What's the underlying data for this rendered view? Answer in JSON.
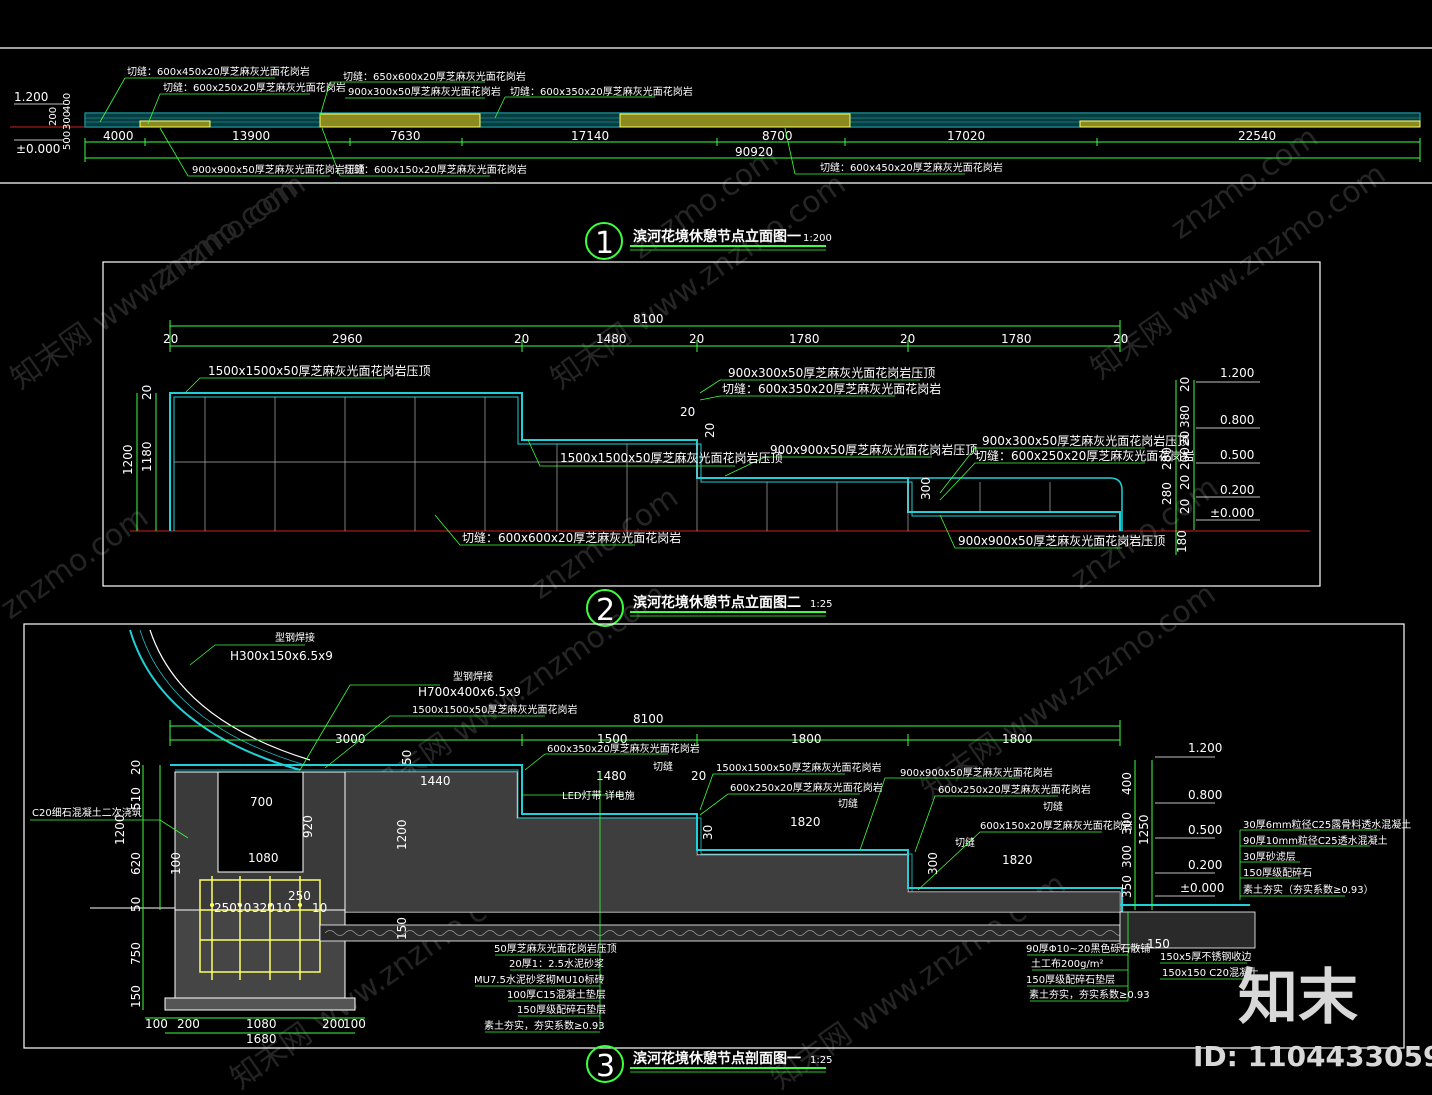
{
  "colors": {
    "background": "#000000",
    "frame": "#ffffff",
    "paving": "#1fd0d8",
    "coping": "#ffff66",
    "leader": "#3cff3c",
    "ground": "#d02020"
  },
  "drawing1": {
    "number": "1",
    "title": "滨河花境休憩节点立面图一",
    "scale": "1:200",
    "levels": [
      "1.200",
      "±0.000"
    ],
    "vertical_dims": [
      "200",
      "500",
      "300",
      "400"
    ],
    "segments": [
      "4000",
      "13900",
      "7630",
      "17140",
      "8700",
      "17020",
      "22540"
    ],
    "total": "90920",
    "notes": {
      "top_a": "切缝：600x450x20厚芝麻灰光面花岗岩",
      "top_b": "切缝：600x250x20厚芝麻灰光面花岗岩",
      "top_c": "切缝：650x600x20厚芝麻灰光面花岗岩",
      "top_d": "900x300x50厚芝麻灰光面花岗岩",
      "top_e": "切缝：600x350x20厚芝麻灰光面花岗岩",
      "bot_a": "900x900x50厚芝麻灰光面花岗岩压顶",
      "bot_b": "切缝：600x150x20厚芝麻灰光面花岗岩",
      "bot_c": "切缝：600x450x20厚芝麻灰光面花岗岩"
    }
  },
  "drawing2": {
    "number": "2",
    "title": "滨河花境休憩节点立面图二",
    "scale": "1:25",
    "total": "8100",
    "top_dims": [
      "20",
      "2960",
      "20",
      "1480",
      "20",
      "1780",
      "20",
      "1780",
      "20"
    ],
    "left_dims": [
      "1200",
      "1180",
      "20"
    ],
    "mid_dims": [
      "20",
      "20",
      "300"
    ],
    "right_dims": [
      "20",
      "380",
      "20",
      "200",
      "280",
      "20",
      "280",
      "20",
      "180"
    ],
    "levels": [
      "1.200",
      "0.800",
      "0.500",
      "0.200",
      "±0.000"
    ],
    "notes": {
      "a": "1500x1500x50厚芝麻灰光面花岗岩压顶",
      "b": "900x300x50厚芝麻灰光面花岗岩压顶",
      "c": "切缝：600x350x20厚芝麻灰光面花岗岩",
      "d": "1500x1500x50厚芝麻灰光面花岗岩压顶",
      "e": "900x900x50厚芝麻灰光面花岗岩压顶",
      "f": "900x300x50厚芝麻灰光面花岗岩压顶",
      "g": "切缝：600x250x20厚芝麻灰光面花岗岩",
      "h": "切缝：600x600x20厚芝麻灰光面花岗岩",
      "i": "900x900x50厚芝麻灰光面花岗岩压顶"
    }
  },
  "drawing3": {
    "number": "3",
    "title": "滨河花境休憩节点剖面图一",
    "scale": "1:25",
    "total": "8100",
    "top_dims": [
      "3000",
      "1500",
      "1800",
      "1800"
    ],
    "sub_dims": [
      "1440",
      "1480",
      "1820",
      "1820"
    ],
    "notes": {
      "steel1_a": "型钢焊接",
      "steel1_b": "H300x150x6.5x9",
      "steel2_a": "型钢焊接",
      "steel2_b": "H700x400x6.5x9",
      "granite_top": "1500x1500x50厚芝麻灰光面花岗岩",
      "cut_350": "600x350x20厚芝麻灰光面花岗岩",
      "cut_word": "切缝",
      "led": "LED灯带  详电施",
      "granite_mid": "1500x1500x50厚芝麻灰光面花岗岩",
      "cut_250a": "600x250x20厚芝麻灰光面花岗岩",
      "granite_900": "900x900x50厚芝麻灰光面花岗岩",
      "cut_250b": "600x250x20厚芝麻灰光面花岗岩",
      "cut_150": "600x150x20厚芝麻灰光面花岗岩",
      "c20": "C20细石混凝土二次浇筑",
      "layer1": "50厚芝麻灰光面花岗岩压顶",
      "layer2": "20厚1：2.5水泥砂浆",
      "layer3": "MU7.5水泥砂浆砌MU10标砖",
      "layer4": "100厚C15混凝土垫层",
      "layer5": "150厚级配碎石垫层",
      "layer6": "素土夯实，夯实系数≥0.93",
      "pave1": "30厚6mm粒径C25露骨料透水混凝土",
      "pave2": "90厚10mm粒径C25透水混凝土",
      "pave3": "30厚砂滤层",
      "pave4": "150厚级配碎石",
      "pave5": "素土夯实（夯实系数≥0.93）",
      "gravel1": "90厚Φ10~20黑色砾石散铺",
      "gravel2": "土工布200g/m²",
      "gravel3": "150厚级配碎石垫层",
      "gravel4": "素土夯实，夯实系数≥0.93",
      "edge1": "150x5厚不锈钢收边",
      "edge2": "150x150 C20混凝土",
      "footing_dims": [
        "100",
        "200",
        "1080",
        "200",
        "100",
        "1680"
      ],
      "footing_inner": [
        "250",
        "10",
        "320",
        "10",
        "250",
        "10",
        "1080",
        "700"
      ],
      "left_vdims": [
        "20",
        "510",
        "1200",
        "620",
        "50",
        "750",
        "150"
      ],
      "levels": [
        "1.200",
        "0.800",
        "0.500",
        "0.200",
        "±0.000"
      ],
      "right_vdims": [
        "400",
        "300",
        "300",
        "1250",
        "350"
      ],
      "misc": [
        "50",
        "1200",
        "920",
        "150",
        "100",
        "20",
        "30",
        "20",
        "300",
        "20",
        "150"
      ]
    }
  },
  "watermark": {
    "text": "znzmo.com",
    "cn": "知末网 www.znzmo.com"
  },
  "brand": {
    "logo": "知末",
    "id": "ID: 1104433059"
  }
}
